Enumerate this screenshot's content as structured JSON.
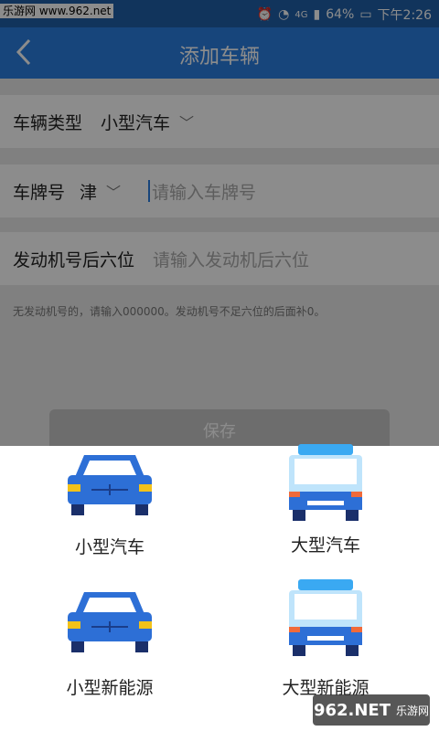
{
  "status": {
    "watermark": "乐游网 www.962.net",
    "battery": "64%",
    "time": "下午2:26",
    "signal": "4G"
  },
  "header": {
    "title": "添加车辆",
    "back_icon": "chevron-left-icon"
  },
  "form": {
    "vehicle_type": {
      "label": "车辆类型",
      "value": "小型汽车"
    },
    "plate": {
      "label": "车牌号",
      "region": "津",
      "placeholder": "请输入车牌号"
    },
    "engine": {
      "label": "发动机号后六位",
      "placeholder": "请输入发动机后六位"
    },
    "note": "无发动机号的，请输入000000。发动机号不足六位的后面补0。",
    "save_label": "保存"
  },
  "sheet": {
    "options": [
      {
        "label": "小型汽车",
        "icon": "sedan-icon"
      },
      {
        "label": "大型汽车",
        "icon": "bus-icon"
      },
      {
        "label": "小型新能源",
        "icon": "sedan-icon"
      },
      {
        "label": "大型新能源",
        "icon": "bus-icon"
      }
    ]
  },
  "watermark_logo": {
    "text": "962.NET",
    "sub": "乐游网"
  },
  "colors": {
    "appbar": "#2b7fe0",
    "statusbar": "#1f5fa8"
  }
}
